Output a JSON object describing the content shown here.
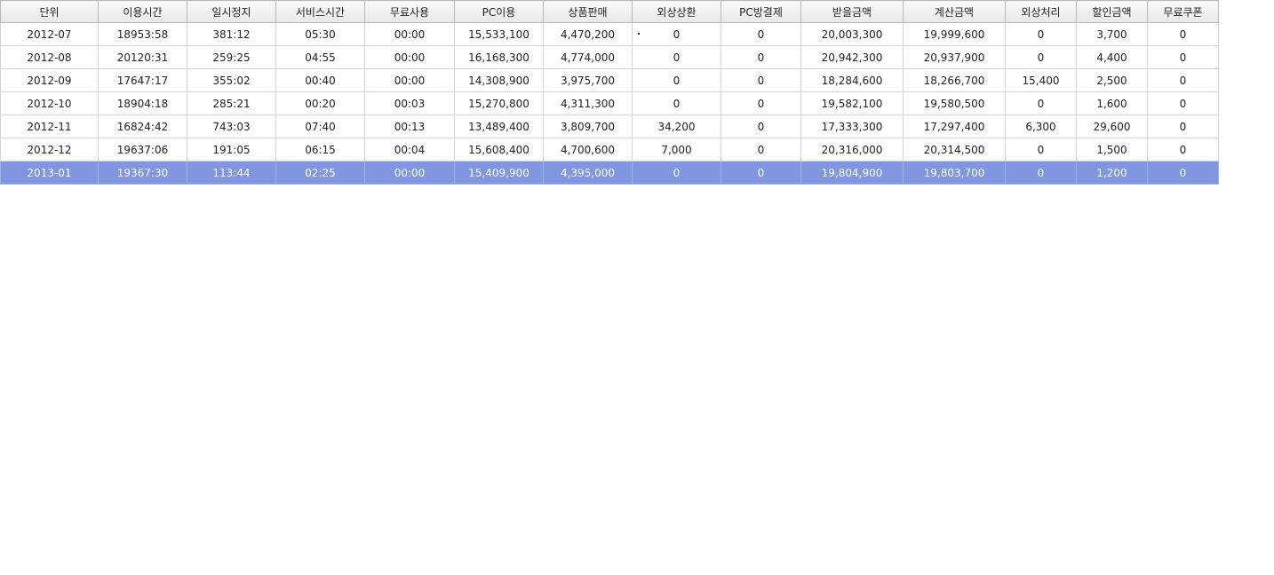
{
  "table": {
    "columns": [
      "단위",
      "이용시간",
      "일시정지",
      "서비스시간",
      "무료사용",
      "PC이용",
      "상품판매",
      "외상상환",
      "PC방결제",
      "받을금액",
      "계산금액",
      "외상처리",
      "할인금액",
      "무료쿠폰"
    ],
    "rows": [
      [
        "2012-07",
        "18953:58",
        "381:12",
        "05:30",
        "00:00",
        "15,533,100",
        "4,470,200",
        "0",
        "0",
        "20,003,300",
        "19,999,600",
        "0",
        "3,700",
        "0"
      ],
      [
        "2012-08",
        "20120:31",
        "259:25",
        "04:55",
        "00:00",
        "16,168,300",
        "4,774,000",
        "0",
        "0",
        "20,942,300",
        "20,937,900",
        "0",
        "4,400",
        "0"
      ],
      [
        "2012-09",
        "17647:17",
        "355:02",
        "00:40",
        "00:00",
        "14,308,900",
        "3,975,700",
        "0",
        "0",
        "18,284,600",
        "18,266,700",
        "15,400",
        "2,500",
        "0"
      ],
      [
        "2012-10",
        "18904:18",
        "285:21",
        "00:20",
        "00:03",
        "15,270,800",
        "4,311,300",
        "0",
        "0",
        "19,582,100",
        "19,580,500",
        "0",
        "1,600",
        "0"
      ],
      [
        "2012-11",
        "16824:42",
        "743:03",
        "07:40",
        "00:13",
        "13,489,400",
        "3,809,700",
        "34,200",
        "0",
        "17,333,300",
        "17,297,400",
        "6,300",
        "29,600",
        "0"
      ],
      [
        "2012-12",
        "19637:06",
        "191:05",
        "06:15",
        "00:04",
        "15,608,400",
        "4,700,600",
        "7,000",
        "0",
        "20,316,000",
        "20,314,500",
        "0",
        "1,500",
        "0"
      ],
      [
        "2013-01",
        "19367:30",
        "113:44",
        "02:25",
        "00:00",
        "15,409,900",
        "4,395,000",
        "0",
        "0",
        "19,804,900",
        "19,803,700",
        "0",
        "1,200",
        "0"
      ]
    ],
    "selected_row": 6
  },
  "colors": {
    "selected_row_bg": "#8196e0",
    "selected_row_text": "#ffffff",
    "header_bg": "#e8e8e8",
    "grid_line": "#d4d4d4"
  }
}
